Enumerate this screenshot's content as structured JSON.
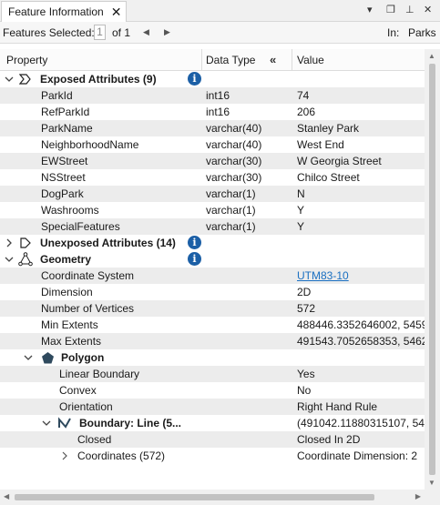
{
  "tab": {
    "label": "Feature Information",
    "close": "✕"
  },
  "window_controls": {
    "menu": "▾",
    "restore": "❐",
    "pin": "⊥",
    "close": "✕"
  },
  "selection": {
    "label": "Features Selected:",
    "current": "1",
    "of_text": "of 1",
    "prev_icon": "◀",
    "next_icon": "▶",
    "in_label": "In:",
    "in_value": "Parks"
  },
  "columns": {
    "property": "Property",
    "data_type": "Data Type",
    "value": "Value",
    "collapse_icon": "«"
  },
  "exposed": {
    "label": "Exposed Attributes (9)",
    "rows": [
      {
        "name": "ParkId",
        "type": "int16",
        "value": "74"
      },
      {
        "name": "RefParkId",
        "type": "int16",
        "value": "206"
      },
      {
        "name": "ParkName",
        "type": "varchar(40)",
        "value": "Stanley Park"
      },
      {
        "name": "NeighborhoodName",
        "type": "varchar(40)",
        "value": "West End"
      },
      {
        "name": "EWStreet",
        "type": "varchar(30)",
        "value": "W Georgia Street"
      },
      {
        "name": "NSStreet",
        "type": "varchar(30)",
        "value": "Chilco Street"
      },
      {
        "name": "DogPark",
        "type": "varchar(1)",
        "value": "N"
      },
      {
        "name": "Washrooms",
        "type": "varchar(1)",
        "value": "Y"
      },
      {
        "name": "SpecialFeatures",
        "type": "varchar(1)",
        "value": "Y"
      }
    ]
  },
  "unexposed": {
    "label": "Unexposed Attributes (14)"
  },
  "geometry": {
    "label": "Geometry",
    "rows": [
      {
        "name": "Coordinate System",
        "value": "UTM83-10"
      },
      {
        "name": "Dimension",
        "value": "2D"
      },
      {
        "name": "Number of Vertices",
        "value": "572"
      },
      {
        "name": "Min Extents",
        "value": "488446.3352646002, 5459"
      },
      {
        "name": "Max Extents",
        "value": "491543.7052658353, 5462"
      }
    ],
    "polygon": {
      "label": "Polygon",
      "rows": [
        {
          "name": "Linear Boundary",
          "value": "Yes"
        },
        {
          "name": "Convex",
          "value": "No"
        },
        {
          "name": "Orientation",
          "value": "Right Hand Rule"
        }
      ],
      "boundary": {
        "label": "Boundary: Line (5...",
        "value": "(491042.11880315107, 546",
        "rows": [
          {
            "name": "Closed",
            "value": "Closed In 2D"
          },
          {
            "name": "Coordinates (572)",
            "value": "Coordinate Dimension: 2"
          }
        ]
      }
    }
  },
  "colors": {
    "link": "#1a6fc1",
    "info": "#1b5fa6",
    "alt_row": "#ececec"
  }
}
